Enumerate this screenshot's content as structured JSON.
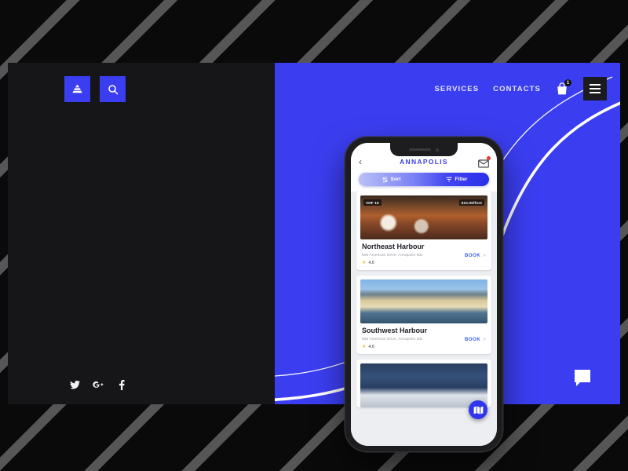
{
  "site": {
    "nav": {
      "links": [
        {
          "label": "SERVICES"
        },
        {
          "label": "CONTACTS"
        }
      ],
      "cart_icon": "shopping-bag-icon",
      "cart_badge": "1",
      "menu_icon": "hamburger-menu-icon"
    },
    "left_panel": {
      "logo_icon": "pyramid-logo-icon",
      "search_icon": "search-icon",
      "social": [
        {
          "name": "twitter-icon",
          "glyph": "🐦"
        },
        {
          "name": "google-plus-icon",
          "glyph": "G+"
        },
        {
          "name": "facebook-icon",
          "glyph": "f"
        }
      ]
    },
    "chat_icon": "chat-bubble-icon",
    "accent_blue": "#3b3ef0",
    "dark": "#161618"
  },
  "phone_app": {
    "header": {
      "back_icon": "back-chevron-icon",
      "title": "ANNAPOLIS",
      "mail_icon": "mail-envelope-icon",
      "mail_badge": true
    },
    "controls": {
      "sort_label": "Sort",
      "sort_icon": "sort-arrows-icon",
      "filter_label": "Filter",
      "filter_icon": "filter-funnel-icon"
    },
    "map_fab_icon": "map-icon",
    "listings": [
      {
        "title": "Northeast Harbour",
        "address": "666 American Drive, Annapolis MD",
        "badge_left": "VHF 16",
        "badge_right": "$10.00/foot",
        "book_label": "BOOK",
        "book_chevron": "»",
        "rating": "4.0",
        "star": "★",
        "photo": "harbour-boats-sunset-photo"
      },
      {
        "title": "Southwest Harbour",
        "address": "666 American Drive, Annapolis MD",
        "badge_left": "",
        "badge_right": "",
        "book_label": "BOOK",
        "book_chevron": "»",
        "rating": "4.0",
        "star": "★",
        "photo": "waterfront-town-photo"
      },
      {
        "title": "",
        "address": "",
        "badge_left": "",
        "badge_right": "",
        "book_label": "",
        "book_chevron": "",
        "rating": "",
        "star": "",
        "photo": "marina-yachts-photo"
      }
    ]
  }
}
